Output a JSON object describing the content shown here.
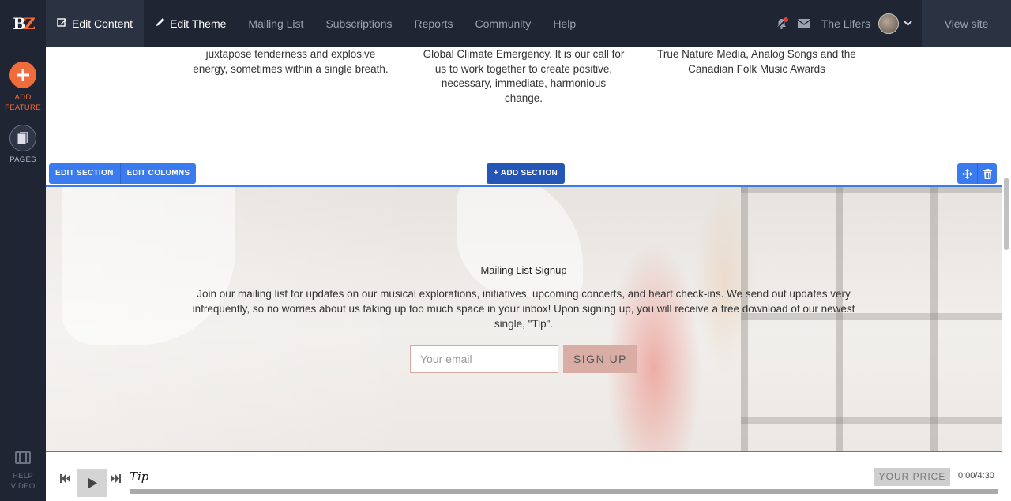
{
  "topbar": {
    "logo_b": "B",
    "logo_z": "Z",
    "nav": [
      {
        "label": "Edit Content",
        "icon": "edit-icon"
      },
      {
        "label": "Edit Theme",
        "icon": "brush-icon"
      },
      {
        "label": "Mailing List"
      },
      {
        "label": "Subscriptions"
      },
      {
        "label": "Reports"
      },
      {
        "label": "Community"
      },
      {
        "label": "Help"
      }
    ],
    "user_name": "The Lifers",
    "view_site": "View site"
  },
  "sidebar": {
    "add_feature": "ADD FEATURE",
    "pages": "PAGES",
    "help_video": "HELP VIDEO"
  },
  "columns": {
    "col1": "juxtapose tenderness and explosive energy, sometimes within a single breath.",
    "col2": "Global Climate Emergency. It is our call for us to work together to create positive, necessary, immediate, harmonious change.",
    "col3": "True Nature Media, Analog Songs and the Canadian Folk Music Awards"
  },
  "section_tools": {
    "edit_section": "EDIT SECTION",
    "edit_columns": "EDIT COLUMNS",
    "add_section": "+ ADD SECTION"
  },
  "mailing": {
    "title": "Mailing List Signup",
    "text": "Join our mailing list for updates on our musical explorations, initiatives, upcoming concerts, and heart check-ins. We send out updates very infrequently, so no worries about us taking up too much space in your inbox! Upon signing up, you will receive a free download of our newest single, \"Tip\".",
    "email_placeholder": "Your email",
    "signup_label": "SIGN UP"
  },
  "player": {
    "track_title": "Tip",
    "your_price": "YOUR PRICE",
    "time": "0:00/4:30",
    "progress": 0
  },
  "colors": {
    "nav_bg": "#1f2533",
    "accent_orange": "#f26b3a",
    "tool_blue": "#3a7cf0",
    "add_section_blue": "#2456b8",
    "signup_pink": "#d9aca4"
  }
}
